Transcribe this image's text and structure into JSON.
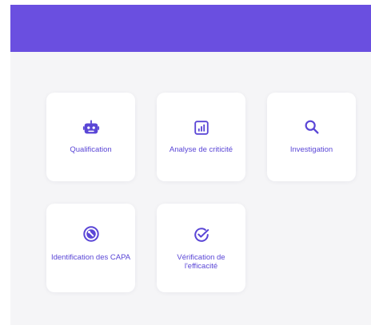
{
  "theme": {
    "accent": "#6a4fe0",
    "text": "#5a46d6",
    "background": "#f5f5f7",
    "card": "#ffffff"
  },
  "cards": [
    {
      "label": "Qualification",
      "icon": "robot-icon"
    },
    {
      "label": "Analyse de criticité",
      "icon": "bar-chart-icon"
    },
    {
      "label": "Investigation",
      "icon": "search-icon"
    },
    {
      "label": "Identification des CAPA",
      "icon": "wrench-icon"
    },
    {
      "label": "Vérification de l'efficacité",
      "icon": "check-circle-icon"
    }
  ]
}
